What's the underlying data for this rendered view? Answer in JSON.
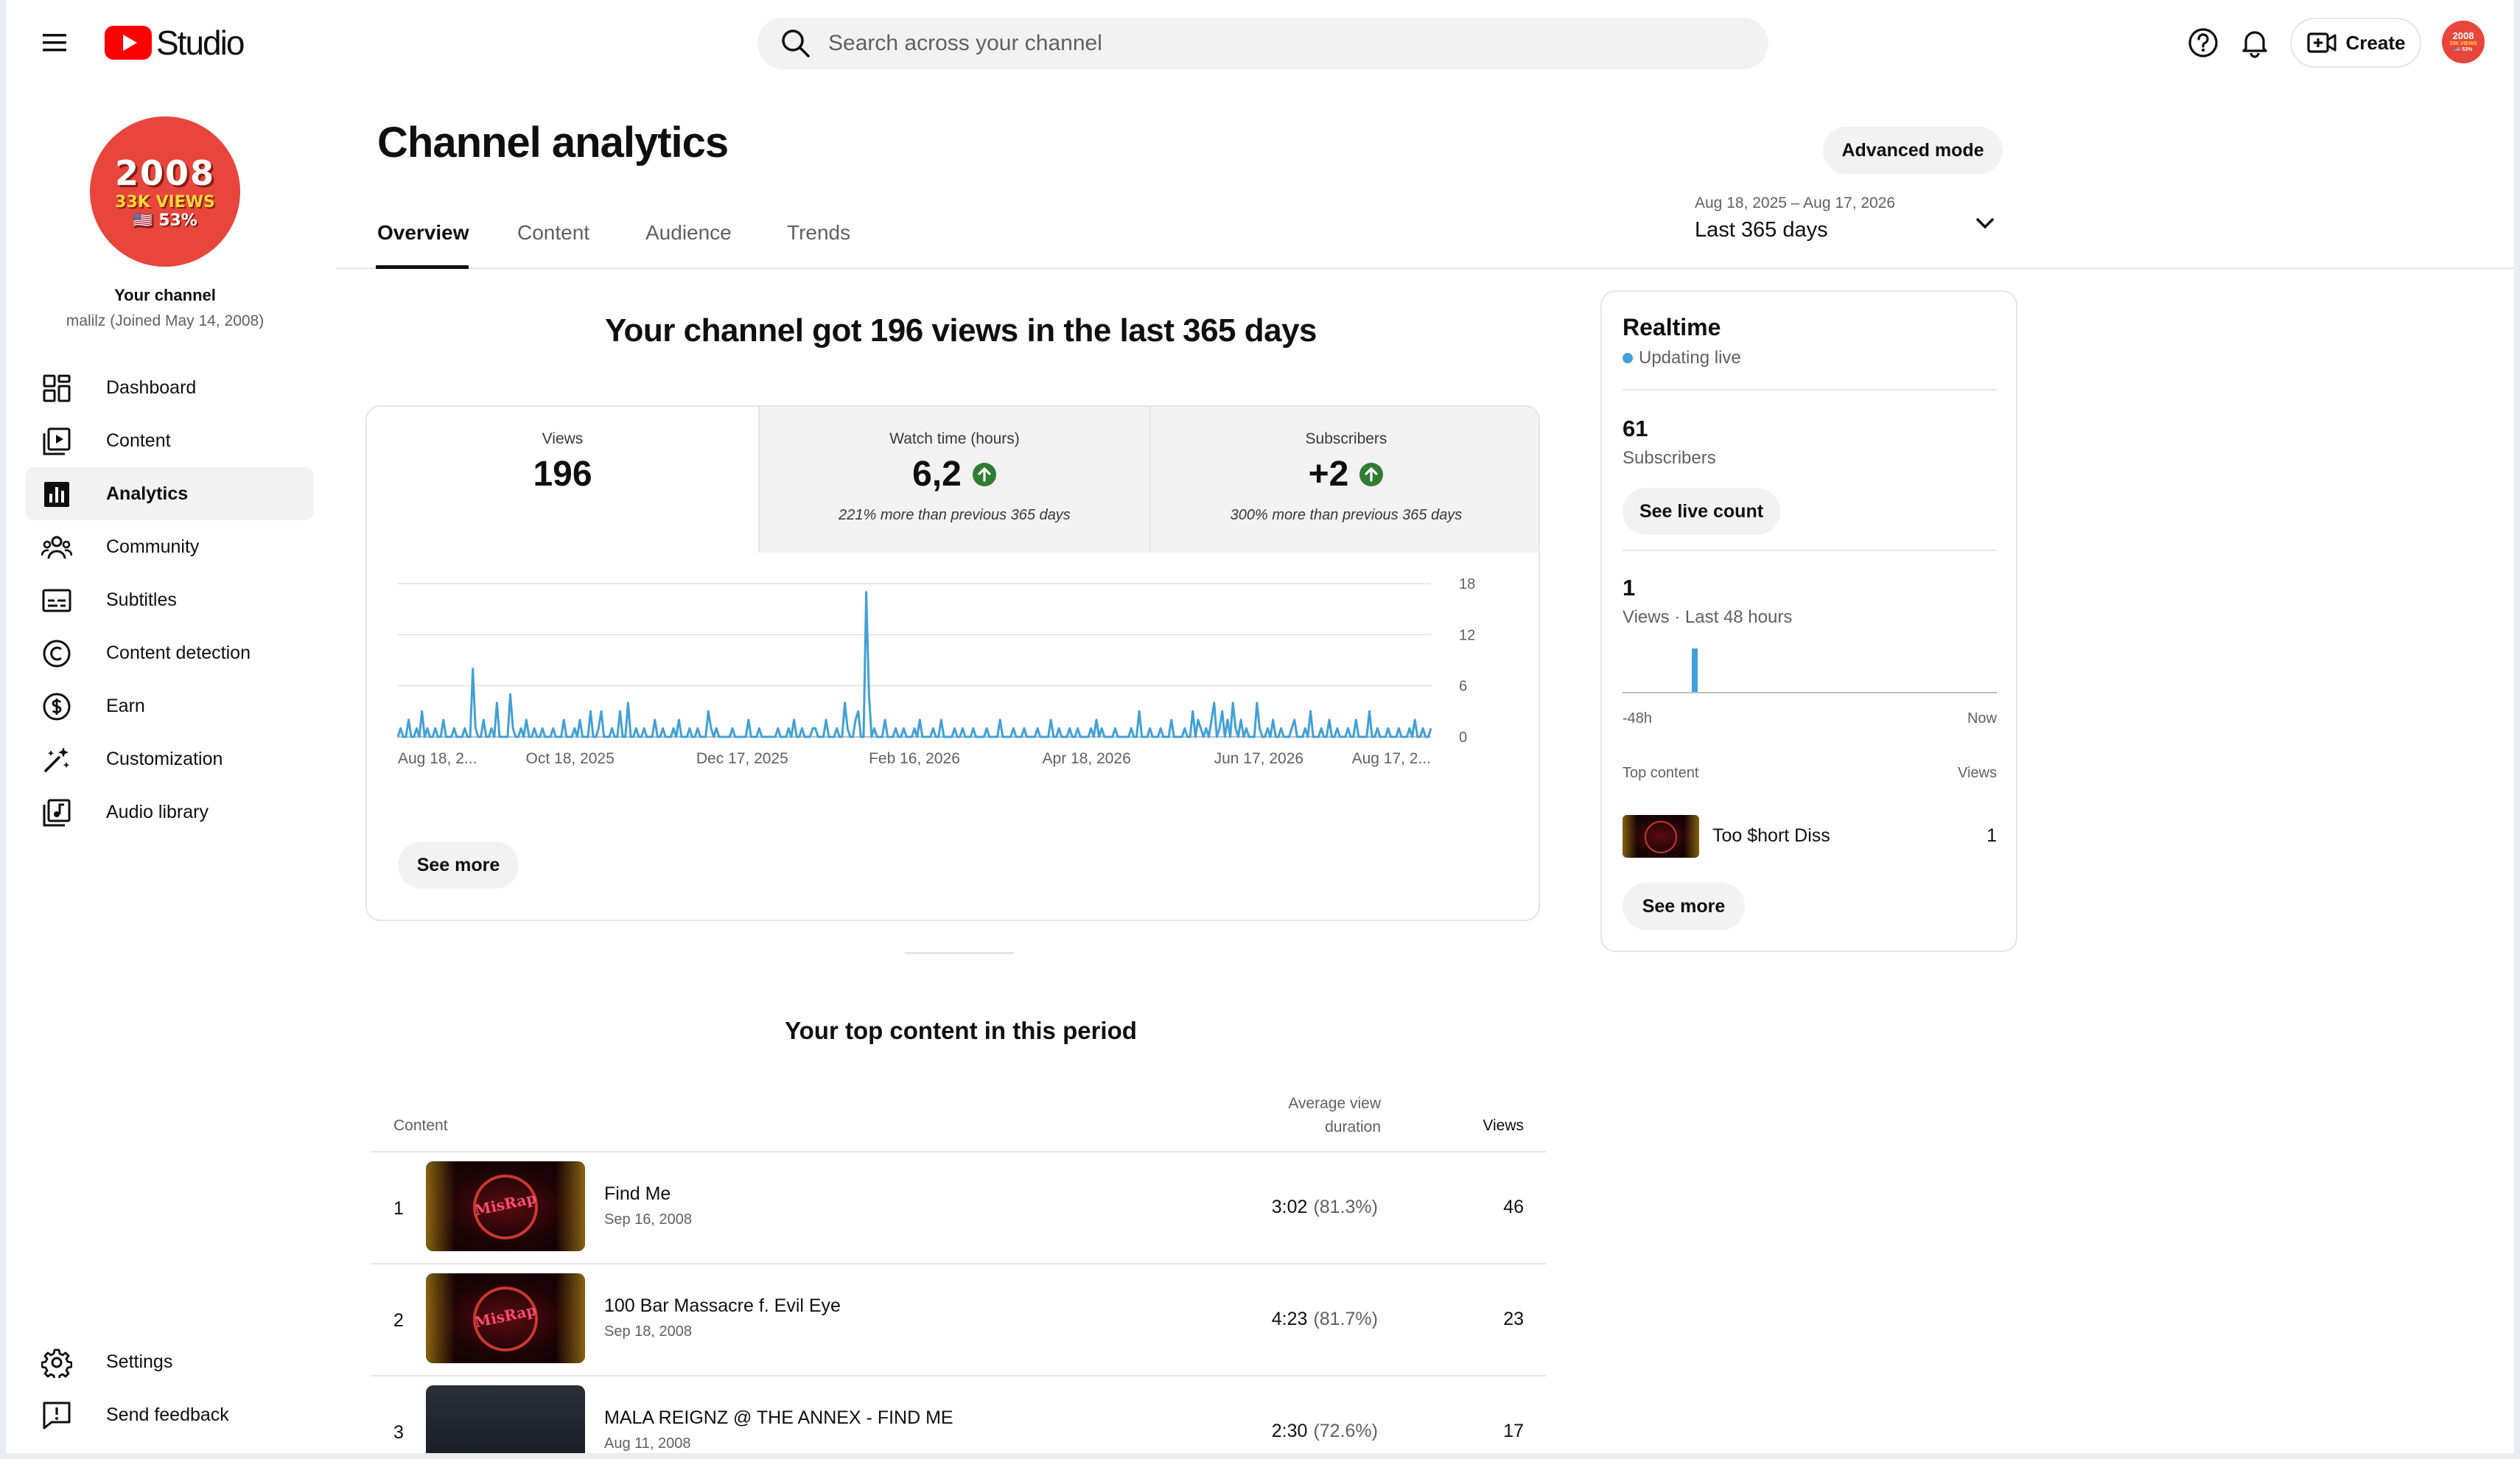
{
  "header": {
    "logo_text": "Studio",
    "search_placeholder": "Search across your channel",
    "create_label": "Create"
  },
  "channel": {
    "avatar": {
      "line1": "2008",
      "line2": "33K VIEWS",
      "line3": "🇺🇸 53%"
    },
    "title": "Your channel",
    "subtitle": "malilz (Joined May 14, 2008)"
  },
  "sidebar": {
    "items": [
      {
        "label": "Dashboard",
        "icon": "dashboard-icon"
      },
      {
        "label": "Content",
        "icon": "content-icon"
      },
      {
        "label": "Analytics",
        "icon": "analytics-icon",
        "active": true
      },
      {
        "label": "Community",
        "icon": "community-icon"
      },
      {
        "label": "Subtitles",
        "icon": "subtitles-icon"
      },
      {
        "label": "Content detection",
        "icon": "copyright-icon"
      },
      {
        "label": "Earn",
        "icon": "dollar-icon"
      },
      {
        "label": "Customization",
        "icon": "magic-wand-icon"
      },
      {
        "label": "Audio library",
        "icon": "audio-library-icon"
      }
    ],
    "bottom": [
      {
        "label": "Settings",
        "icon": "gear-icon"
      },
      {
        "label": "Send feedback",
        "icon": "feedback-icon"
      }
    ]
  },
  "page": {
    "title": "Channel analytics",
    "advanced_mode": "Advanced mode",
    "tabs": [
      "Overview",
      "Content",
      "Audience",
      "Trends"
    ],
    "active_tab": "Overview",
    "date_range": "Aug 18, 2025 – Aug 17, 2026",
    "date_label": "Last 365 days"
  },
  "summary": {
    "headline": "Your channel got 196 views in the last 365 days",
    "metrics": [
      {
        "label": "Views",
        "value": "196",
        "note": ""
      },
      {
        "label": "Watch time (hours)",
        "value": "6,2",
        "note": "221% more than previous 365 days",
        "trend": "up"
      },
      {
        "label": "Subscribers",
        "value": "+2",
        "note": "300% more than previous 365 days",
        "trend": "up"
      }
    ],
    "see_more": "See more"
  },
  "chart_data": {
    "type": "line",
    "series": [
      {
        "values": [
          0,
          1,
          0,
          0,
          2,
          0,
          0,
          1,
          0,
          3,
          0,
          1,
          0,
          0,
          1,
          0,
          0,
          2,
          0,
          0,
          0,
          1,
          0,
          0,
          0,
          1,
          0,
          0,
          8,
          1,
          0,
          0,
          2,
          0,
          0,
          1,
          0,
          4,
          0,
          0,
          0,
          0,
          5,
          1,
          0,
          0,
          1,
          0,
          2,
          0,
          0,
          1,
          0,
          0,
          1,
          0,
          0,
          0,
          1,
          0,
          0,
          0,
          2,
          0,
          0,
          0,
          1,
          0,
          2,
          0,
          0,
          0,
          3,
          0,
          0,
          1,
          3,
          0,
          0,
          0,
          1,
          0,
          0,
          3,
          0,
          0,
          4,
          0,
          0,
          1,
          0,
          0,
          1,
          0,
          0,
          0,
          2,
          0,
          0,
          1,
          0,
          0,
          0,
          1,
          0,
          2,
          0,
          0,
          0,
          1,
          0,
          0,
          1,
          0,
          0,
          0,
          3,
          1,
          0,
          1,
          0,
          0,
          0,
          0,
          0,
          1,
          0,
          0,
          0,
          0,
          0,
          2,
          0,
          0,
          0,
          1,
          0,
          0,
          0,
          0,
          0,
          0,
          1,
          0,
          0,
          0,
          1,
          0,
          2,
          0,
          0,
          1,
          0,
          0,
          0,
          1,
          1,
          0,
          0,
          0,
          2,
          0,
          0,
          0,
          1,
          0,
          0,
          4,
          1,
          0,
          0,
          2,
          3,
          0,
          0,
          17,
          5,
          0,
          1,
          0,
          0,
          0,
          2,
          0,
          0,
          0,
          1,
          0,
          0,
          1,
          0,
          0,
          0,
          1,
          0,
          2,
          0,
          0,
          0,
          0,
          1,
          0,
          0,
          2,
          0,
          0,
          0,
          0,
          1,
          0,
          0,
          1,
          0,
          0,
          0,
          1,
          0,
          0,
          0,
          0,
          1,
          0,
          0,
          0,
          0,
          2,
          0,
          0,
          0,
          0,
          1,
          0,
          0,
          0,
          1,
          0,
          0,
          0,
          0,
          1,
          0,
          0,
          0,
          0,
          2,
          0,
          0,
          1,
          0,
          0,
          0,
          1,
          0,
          0,
          1,
          0,
          0,
          0,
          0,
          1,
          0,
          2,
          0,
          1,
          0,
          0,
          0,
          0,
          1,
          0,
          0,
          0,
          0,
          0,
          1,
          0,
          0,
          3,
          0,
          0,
          0,
          1,
          0,
          0,
          0,
          1,
          0,
          0,
          0,
          2,
          0,
          0,
          0,
          0,
          1,
          0,
          0,
          3,
          0,
          2,
          1,
          0,
          1,
          0,
          2,
          4,
          0,
          1,
          3,
          0,
          2,
          0,
          4,
          1,
          0,
          2,
          0,
          1,
          0,
          0,
          0,
          4,
          1,
          0,
          0,
          1,
          0,
          2,
          0,
          0,
          1,
          0,
          0,
          0,
          1,
          2,
          0,
          0,
          0,
          1,
          0,
          3,
          0,
          0,
          0,
          1,
          0,
          0,
          2,
          0,
          0,
          1,
          0,
          0,
          0,
          1,
          0,
          0,
          2,
          0,
          0,
          0,
          0,
          3,
          0,
          0,
          1,
          0,
          0,
          0,
          1,
          0,
          0,
          0,
          1,
          0,
          0,
          0,
          1,
          0,
          2,
          0,
          0,
          1,
          0,
          0,
          1
        ]
      }
    ],
    "x_ticks": [
      "Aug 18, 2...",
      "Oct 18, 2025",
      "Dec 17, 2025",
      "Feb 16, 2026",
      "Apr 18, 2026",
      "Jun 17, 2026",
      "Aug 17, 2..."
    ],
    "y_ticks": [
      "0",
      "6",
      "12",
      "18"
    ],
    "ylim": [
      0,
      18
    ],
    "grid": true,
    "color": "#41a0d8"
  },
  "top_content": {
    "title": "Your top content in this period",
    "col_content": "Content",
    "col_avd": [
      "Average view",
      "duration"
    ],
    "col_views": "Views",
    "rows": [
      {
        "rank": "1",
        "title": "Find Me",
        "date": "Sep 16, 2008",
        "duration": "3:02",
        "pct": "(81.3%)",
        "views": "46"
      },
      {
        "rank": "2",
        "title": "100 Bar Massacre f. Evil Eye",
        "date": "Sep 18, 2008",
        "duration": "4:23",
        "pct": "(81.7%)",
        "views": "23"
      },
      {
        "rank": "3",
        "title": "MALA REIGNZ @ THE ANNEX - FIND ME",
        "date": "Aug 11, 2008",
        "duration": "2:30",
        "pct": "(72.6%)",
        "views": "17"
      }
    ]
  },
  "realtime": {
    "title": "Realtime",
    "status": "Updating live",
    "subscribers": {
      "value": "61",
      "label": "Subscribers",
      "button": "See live count"
    },
    "views": {
      "value": "1",
      "label": "Views · Last 48 hours",
      "axis_start": "-48h",
      "axis_end": "Now"
    },
    "top_content_label": "Top content",
    "views_label": "Views",
    "top_item": {
      "title": "Too $hort Diss",
      "views": "1"
    },
    "see_more": "See more"
  },
  "colors": {
    "accent": "#41a0d8",
    "brand_red": "#ff0000",
    "trend_green": "#2e7d32"
  }
}
